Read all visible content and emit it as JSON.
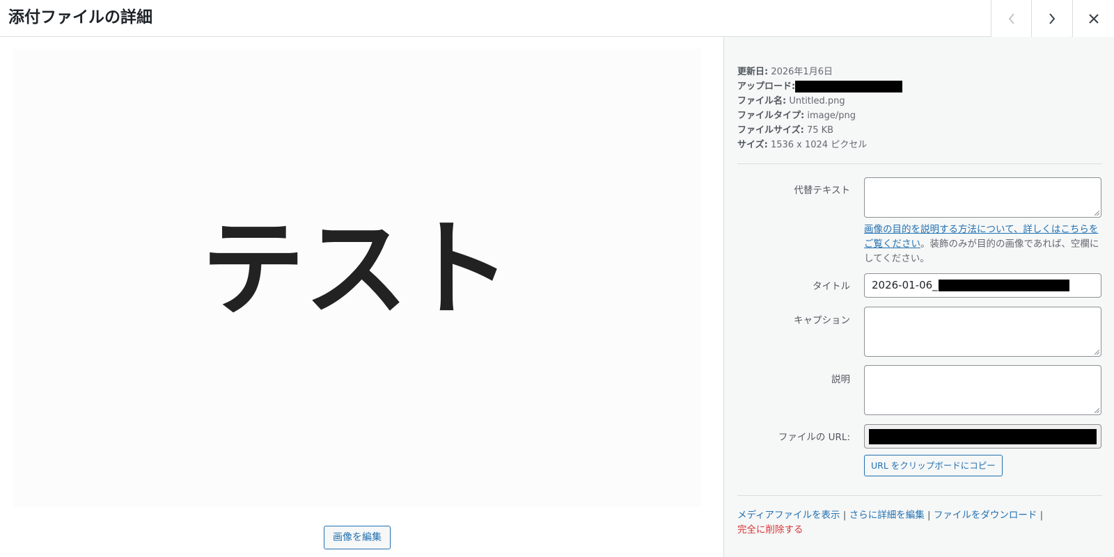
{
  "header": {
    "title": "添付ファイルの詳細",
    "prev_icon": "chevron-left-icon",
    "next_icon": "chevron-right-icon",
    "close_icon": "close-icon"
  },
  "preview": {
    "image_text": "テスト",
    "edit_button": "画像を編集"
  },
  "meta": {
    "updated_label": "更新日:",
    "updated_value": "2026年1月6日",
    "uploaded_label": "アップロード:",
    "uploaded_value": "",
    "filename_label": "ファイル名:",
    "filename_value": "Untitled.png",
    "filetype_label": "ファイルタイプ:",
    "filetype_value": "image/png",
    "filesize_label": "ファイルサイズ:",
    "filesize_value": "75 KB",
    "dimensions_label": "サイズ:",
    "dimensions_value": "1536 x 1024 ピクセル"
  },
  "fields": {
    "alt_label": "代替テキスト",
    "alt_value": "",
    "alt_help_link": "画像の目的を説明する方法について、詳しくはこちらをご覧ください",
    "alt_help_text": "。装飾のみが目的の画像であれば、空欄にしてください。",
    "title_label": "タイトル",
    "title_value": "2026-01-06_",
    "caption_label": "キャプション",
    "caption_value": "",
    "description_label": "説明",
    "description_value": "",
    "url_label": "ファイルの URL:",
    "url_value": "",
    "copy_button": "URL をクリップボードにコピー"
  },
  "actions": {
    "view": "メディアファイルを表示",
    "edit_more": "さらに詳細を編集",
    "download": "ファイルをダウンロード",
    "separator": "|",
    "delete": "完全に削除する"
  },
  "colors": {
    "link": "#2271b1",
    "delete": "#d63638",
    "redaction": "#000000"
  }
}
